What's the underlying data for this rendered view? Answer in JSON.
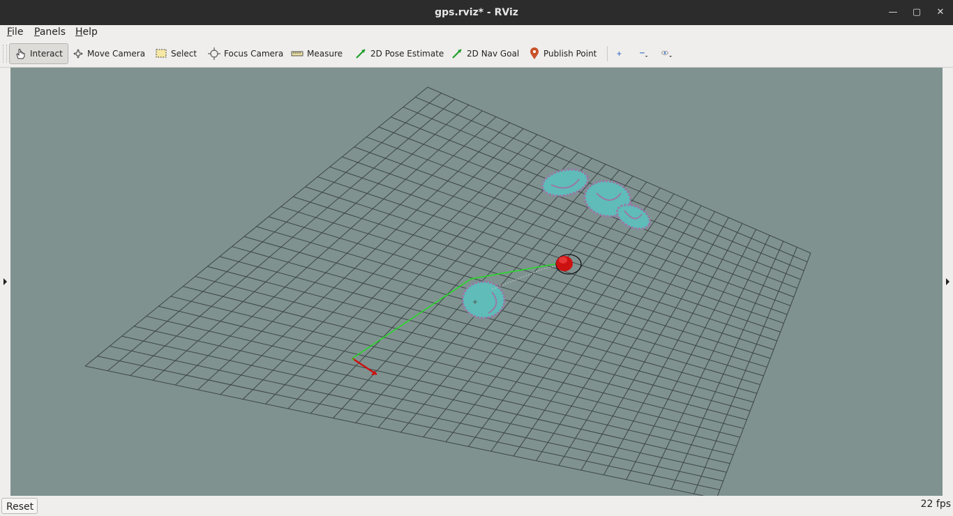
{
  "window": {
    "title": "gps.rviz* - RViz"
  },
  "menu": {
    "file": "File",
    "panels": "Panels",
    "help": "Help"
  },
  "toolbar": {
    "interact": "Interact",
    "move_camera": "Move Camera",
    "select": "Select",
    "focus_camera": "Focus Camera",
    "measure": "Measure",
    "pose_estimate": "2D Pose Estimate",
    "nav_goal": "2D Nav Goal",
    "publish_point": "Publish Point"
  },
  "status": {
    "reset": "Reset",
    "fps": "22 fps"
  },
  "colors": {
    "background": "#7f9290",
    "grid": "#3d4544",
    "costmap": "#5fbcb8",
    "path": "#22dd22",
    "robot": "#cc1111"
  }
}
